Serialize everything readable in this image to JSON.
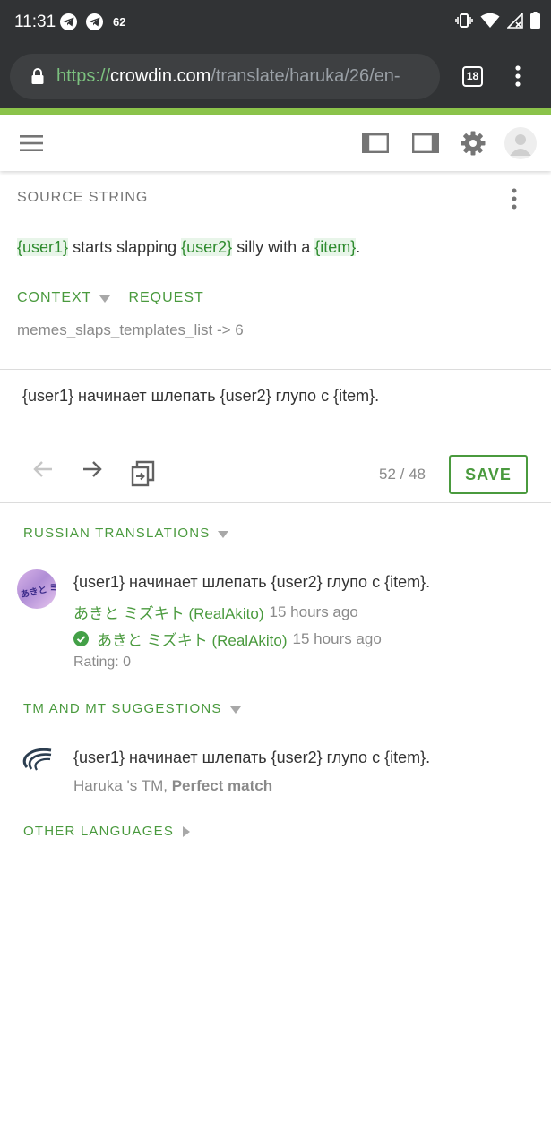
{
  "status_bar": {
    "time": "11:31",
    "notification_count": "62"
  },
  "browser": {
    "url_scheme": "https://",
    "url_host": "crowdin.com",
    "url_path": "/translate/haruka/26/en-",
    "tab_count": "18"
  },
  "source": {
    "section_label": "SOURCE STRING",
    "parts": [
      {
        "text": "{user1}",
        "placeholder": true
      },
      {
        "text": " starts slapping ",
        "placeholder": false
      },
      {
        "text": "{user2}",
        "placeholder": true
      },
      {
        "text": " silly with a ",
        "placeholder": false
      },
      {
        "text": "{item}",
        "placeholder": true
      },
      {
        "text": ".",
        "placeholder": false
      }
    ],
    "context_label": "CONTEXT",
    "request_label": "REQUEST",
    "context_value": "memes_slaps_templates_list -> 6"
  },
  "editor": {
    "translation_text": "{user1} начинает шлепать {user2} глупо с {item}.",
    "counter": "52 / 48",
    "save_label": "SAVE"
  },
  "russian_translations": {
    "section_label": "RUSSIAN TRANSLATIONS",
    "avatar_text": "あきと ミズキト",
    "item": {
      "text": "{user1} начинает шлепать {user2} глупо с {item}.",
      "author": "あきと ミズキト (RealAkito)",
      "time": "15 hours ago",
      "approved_by": "あきと ミズキト (RealAkito)",
      "approved_time": "15 hours ago",
      "rating": "Rating: 0"
    }
  },
  "tm_suggestions": {
    "section_label": "TM AND MT SUGGESTIONS",
    "item": {
      "text": "{user1} начинает шлепать {user2} глупо с {item}.",
      "source": "Haruka 's TM, ",
      "match": "Perfect match"
    }
  },
  "other_languages": {
    "section_label": "OTHER LANGUAGES"
  },
  "colors": {
    "accent": "#4a9a3e",
    "progress": "#8bc34a",
    "chrome": "#313335"
  }
}
